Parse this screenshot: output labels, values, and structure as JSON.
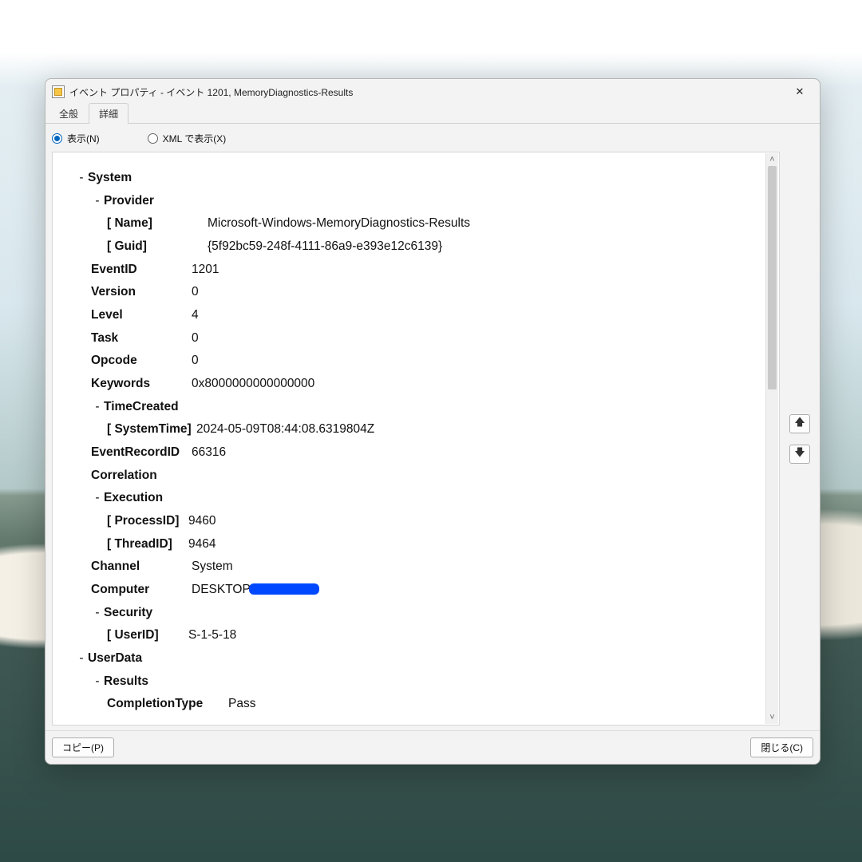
{
  "window": {
    "title": "イベント プロパティ - イベント 1201, MemoryDiagnostics-Results"
  },
  "tabs": {
    "general": "全般",
    "details": "詳細"
  },
  "view": {
    "friendly": "表示(N)",
    "xml": "XML で表示(X)"
  },
  "tree": {
    "system_label": "System",
    "provider_label": "Provider",
    "provider_name_key": "Name",
    "provider_name_val": "Microsoft-Windows-MemoryDiagnostics-Results",
    "provider_guid_key": "Guid",
    "provider_guid_val": "{5f92bc59-248f-4111-86a9-e393e12c6139}",
    "eventid_key": "EventID",
    "eventid_val": "1201",
    "version_key": "Version",
    "version_val": "0",
    "level_key": "Level",
    "level_val": "4",
    "task_key": "Task",
    "task_val": "0",
    "opcode_key": "Opcode",
    "opcode_val": "0",
    "keywords_key": "Keywords",
    "keywords_val": "0x8000000000000000",
    "timecreated_label": "TimeCreated",
    "systemtime_key": "SystemTime",
    "systemtime_val": "2024-05-09T08:44:08.6319804Z",
    "eventrecordid_key": "EventRecordID",
    "eventrecordid_val": "66316",
    "correlation_key": "Correlation",
    "execution_label": "Execution",
    "processid_key": "ProcessID",
    "processid_val": "9460",
    "threadid_key": "ThreadID",
    "threadid_val": "9464",
    "channel_key": "Channel",
    "channel_val": "System",
    "computer_key": "Computer",
    "computer_val": "DESKTOP",
    "security_label": "Security",
    "userid_key": "UserID",
    "userid_val": "S-1-5-18",
    "userdata_label": "UserData",
    "results_label": "Results",
    "completiontype_key": "CompletionType",
    "completiontype_val": "Pass"
  },
  "buttons": {
    "copy": "コピー(P)",
    "close": "閉じる(C)"
  }
}
